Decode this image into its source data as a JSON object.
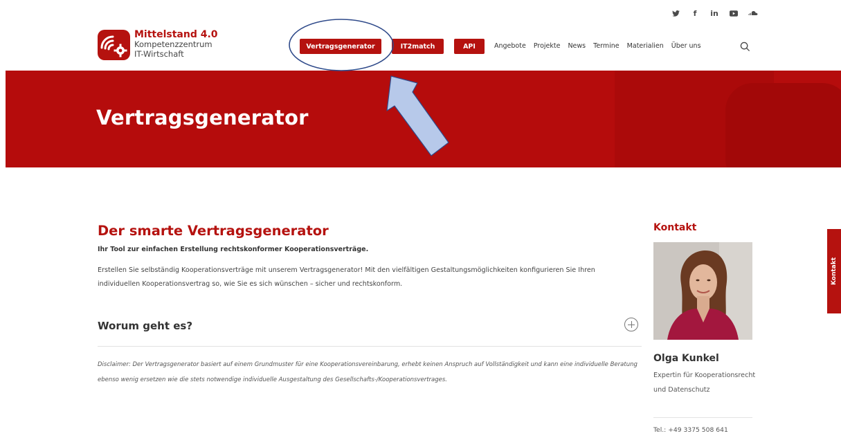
{
  "social": [
    "twitter",
    "facebook",
    "linkedin",
    "youtube",
    "soundcloud"
  ],
  "social_glyphs": {
    "facebook": "f",
    "linkedin": "in"
  },
  "logo": {
    "title": "Mittelstand 4.0",
    "line1": "Kompetenzzentrum",
    "line2": "IT-Wirtschaft"
  },
  "nav": {
    "buttons": [
      "Vertragsgenerator",
      "IT2match",
      "API"
    ],
    "links": [
      "Angebote",
      "Projekte",
      "News",
      "Termine",
      "Materialien",
      "Über uns"
    ]
  },
  "hero": {
    "title": "Vertragsgenerator"
  },
  "main": {
    "heading": "Der smarte Vertragsgenerator",
    "lead": "Ihr Tool zur einfachen Erstellung rechtskonformer Kooperationsverträge.",
    "paragraph": "Erstellen Sie selbständig Kooperationsverträge mit unserem Vertragsgenerator! Mit den vielfältigen Gestaltungsmöglichkeiten konfigurieren Sie Ihren individuellen Kooperationsvertrag so, wie Sie es sich wünschen – sicher und rechtskonform.",
    "accordion_title": "Worum geht es?",
    "disclaimer": "Disclaimer: Der Vertragsgenerator basiert auf einem Grundmuster für eine Kooperationsvereinbarung, erhebt keinen Anspruch auf Vollständigkeit und kann eine individuelle Beratung ebenso wenig ersetzen wie die stets notwendige individuelle Ausgestaltung des Gesellschafts-/Kooperationsvertrages."
  },
  "sidebar": {
    "heading": "Kontakt",
    "name": "Olga Kunkel",
    "role": "Expertin für Kooperationsrecht und Datenschutz",
    "tel": "Tel.: +49 3375 508 641"
  },
  "side_tab": "Kontakt",
  "colors": {
    "brand_red": "#b5120f",
    "hero_red": "#b50c0c",
    "annotation_arrow": "#b7c9ea",
    "annotation_stroke": "#2f4a8a"
  }
}
